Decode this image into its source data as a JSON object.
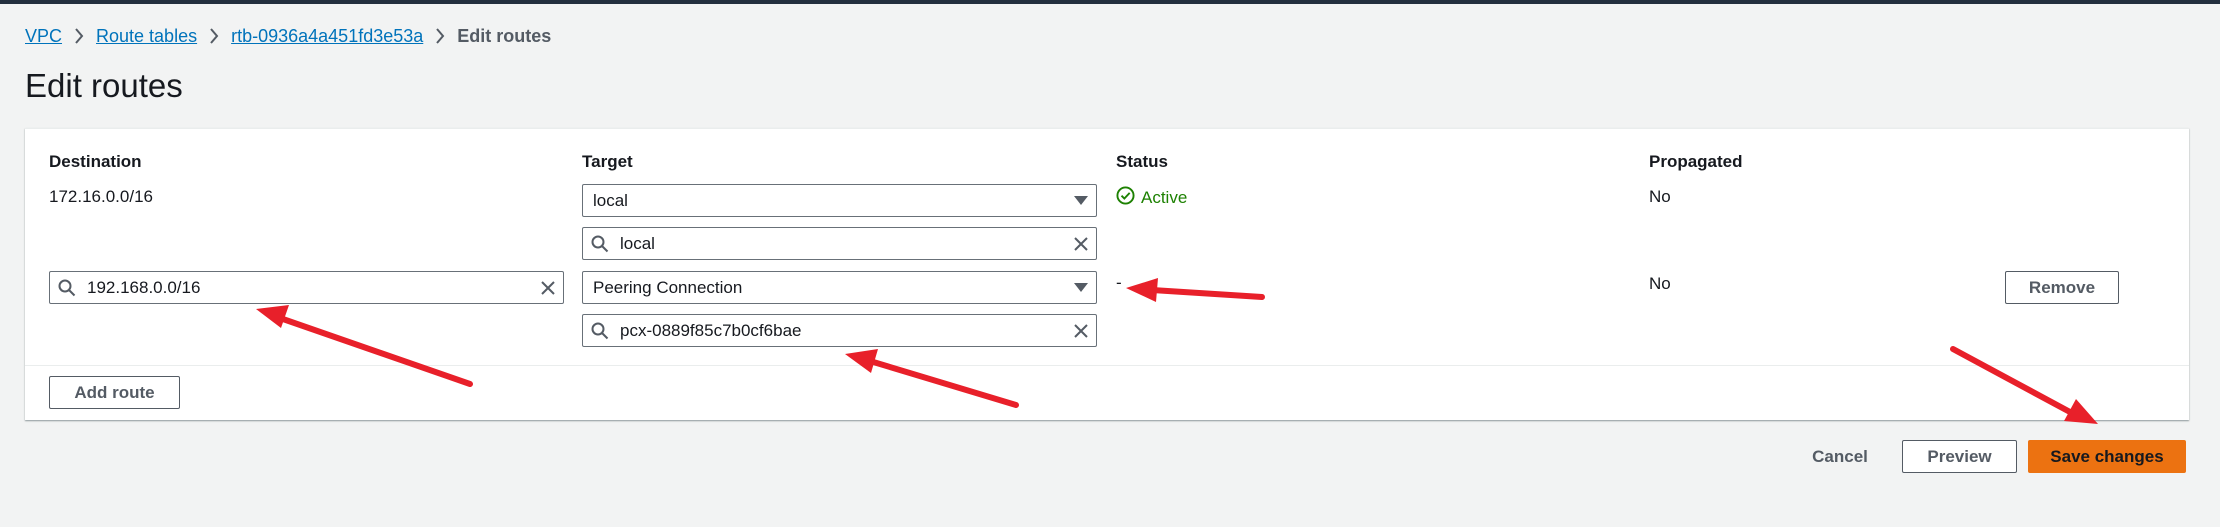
{
  "breadcrumb": {
    "items": [
      "VPC",
      "Route tables",
      "rtb-0936a4a451fd3e53a"
    ],
    "current": "Edit routes"
  },
  "page": {
    "title": "Edit routes"
  },
  "table": {
    "headers": {
      "destination": "Destination",
      "target": "Target",
      "status": "Status",
      "propagated": "Propagated"
    },
    "rows": [
      {
        "destination": "172.16.0.0/16",
        "target_type": "local",
        "target_value": "local",
        "status": "Active",
        "propagated": "No"
      },
      {
        "destination": "192.168.0.0/16",
        "target_type": "Peering Connection",
        "target_value": "pcx-0889f85c7b0cf6bae",
        "status": "-",
        "propagated": "No",
        "remove_label": "Remove"
      }
    ]
  },
  "actions": {
    "add_route": "Add route",
    "cancel": "Cancel",
    "preview": "Preview",
    "save": "Save changes"
  },
  "colors": {
    "link": "#0073bb",
    "status_active": "#1d8102",
    "primary_button": "#ec7211",
    "annotation_arrow": "#e8202a"
  }
}
